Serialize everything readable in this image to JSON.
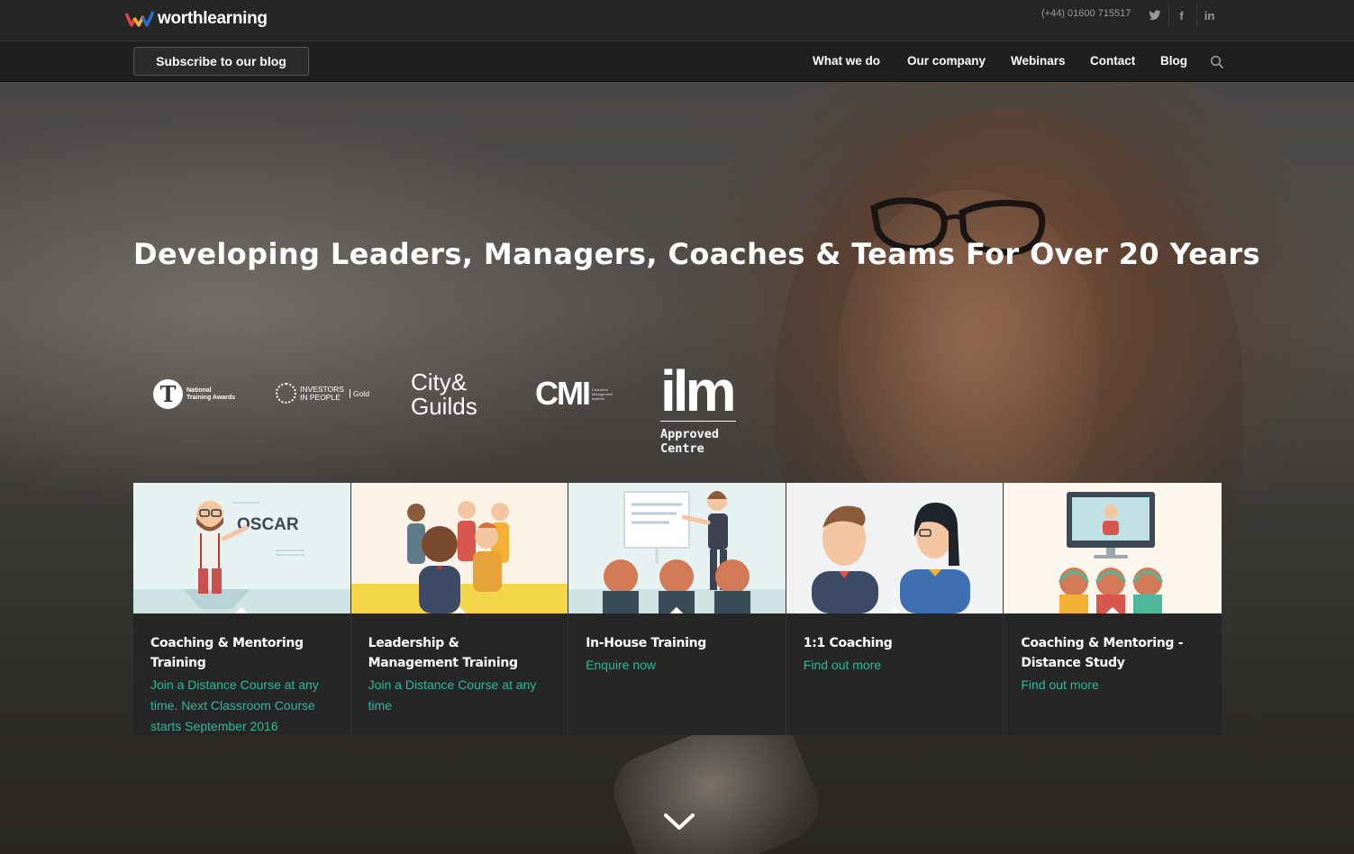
{
  "brand": {
    "name": "worthlearning",
    "logo_icon": "w-mark-icon"
  },
  "topbar": {
    "phone": "(+44) 01600 715517",
    "social": [
      {
        "name": "twitter",
        "glyph": "🐦"
      },
      {
        "name": "facebook",
        "glyph": "f"
      },
      {
        "name": "linkedin",
        "glyph": "in"
      }
    ]
  },
  "navbar": {
    "subscribe_label": "Subscribe to our blog",
    "menu": [
      "What we do",
      "Our company",
      "Webinars",
      "Contact",
      "Blog"
    ],
    "search_icon": "search-icon"
  },
  "hero": {
    "headline": "Developing Leaders, Managers, Coaches & Teams For Over 20 Years"
  },
  "accreditations": {
    "nta": {
      "letter": "T",
      "text_line1": "National",
      "text_line2": "Training Awards"
    },
    "iip": {
      "line1": "INVESTORS",
      "line2": "IN PEOPLE",
      "level": "Gold"
    },
    "cg": {
      "line1": "City&",
      "line2": "Guilds"
    },
    "cmi": {
      "abbr": "CMI",
      "small": "Chartered Management Institute"
    },
    "ilm": {
      "abbr": "ilm",
      "line1": "Approved",
      "line2": "Centre"
    }
  },
  "cards": [
    {
      "title": "Coaching & Mentoring Training",
      "link": "Join a Distance Course at any time. Next Classroom Course starts September 2016",
      "image_label": "OSCAR"
    },
    {
      "title": "Leadership & Management Training",
      "link": "Join a Distance Course at any time"
    },
    {
      "title": "In-House Training",
      "link": "Enquire now"
    },
    {
      "title": "1:1 Coaching",
      "link": "Find out more"
    },
    {
      "title": "Coaching & Mentoring - Distance Study",
      "link": "Find out more"
    }
  ],
  "colors": {
    "accent": "#2fb89a",
    "card_bg": "#262626",
    "topbar_bg": "#262626",
    "nav_bg": "#1f1f1f"
  }
}
